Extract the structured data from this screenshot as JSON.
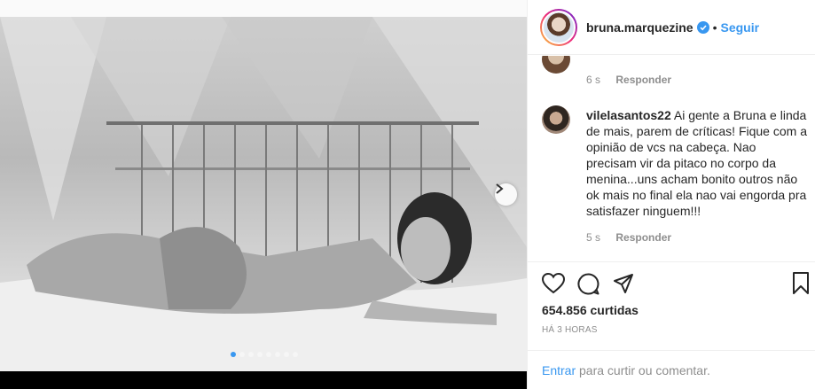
{
  "post": {
    "username": "bruna.marquezine",
    "verified_icon": "verified-badge-icon",
    "separator": "•",
    "follow_label": "Seguir"
  },
  "carousel": {
    "slides": 8,
    "active_index": 0
  },
  "comments": [
    {
      "time": "6 s",
      "reply_label": "Responder"
    },
    {
      "username": "vilelasantos22",
      "text": "Ai gente a Bruna e linda de mais, parem de críticas! Fique com a opinião de vcs na cabeça. Nao precisam vir da pitaco no corpo da menina...uns acham bonito outros não ok mais no final ela nao vai engorda pra satisfazer ninguem!!!",
      "time": "5 s",
      "reply_label": "Responder"
    }
  ],
  "actions": {
    "likes_text": "654.856 curtidas",
    "time_ago": "HÁ 3 HORAS"
  },
  "add_comment": {
    "login_link": "Entrar",
    "prompt": " para curtir ou comentar."
  },
  "colors": {
    "accent": "#3897f0",
    "text": "#262626",
    "muted": "#8e8e8e",
    "border": "#efefef"
  }
}
